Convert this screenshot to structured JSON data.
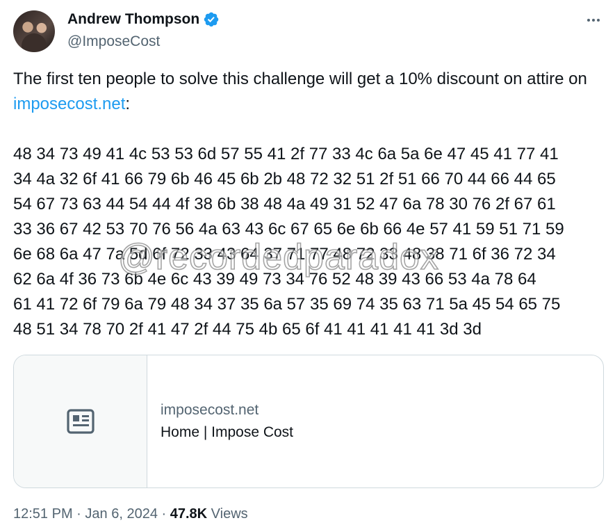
{
  "author": {
    "display_name": "Andrew Thompson",
    "handle": "@ImposeCost",
    "verified": true
  },
  "tweet": {
    "text_before_link": "The first ten people to solve this challenge will get a 10% discount on attire on ",
    "link_text": "imposecost.net",
    "text_after_link": ":",
    "hex_lines": [
      "48 34 73 49 41 4c 53 53 6d 57 55 41 2f 77 33 4c 6a 5a 6e 47 45 41 77 41",
      "34 4a 32 6f 41 66 79 6b 46 45 6b 2b 48 72 32 51 2f 51 66 70 44 66 44 65",
      "54 67 73 63 44 54 44 4f 38 6b 38 48 4a 49 31 52 47 6a 78 30 76 2f 67 61",
      "33 36 67 42 53 70 76 56 4a 63 43 6c 67 65 6e 6b 66 4e 57 41 59 51 71 59",
      "6e 68 6a 47 7a 5d 6f 72 33 43 64 37 71 77 48 72 33 48 38 71 6f 36 72 34",
      "62 6a 4f 36 73 6b 4e 6c 43 39 49 73 34 76 52 48 39 43 66 53 4a 78 64",
      "61 41 72 6f 79 6a 79 48 34 37 35 6a 57 35 69 74 35 63 71 5a 45 54 65 75",
      "48 51 34 78 70 2f 41 47 2f 44 75 4b 65 6f 41 41 41 41 41 3d 3d"
    ]
  },
  "watermark": "@recordedparadox",
  "link_card": {
    "domain": "imposecost.net",
    "title": "Home | Impose Cost",
    "thumb_icon": "article-icon"
  },
  "meta": {
    "time": "12:51 PM",
    "separator": "·",
    "date": "Jan 6, 2024",
    "views_count": "47.8K",
    "views_label": "Views"
  },
  "colors": {
    "link": "#1d9bf0",
    "muted": "#536471",
    "border": "#cfd9de"
  }
}
